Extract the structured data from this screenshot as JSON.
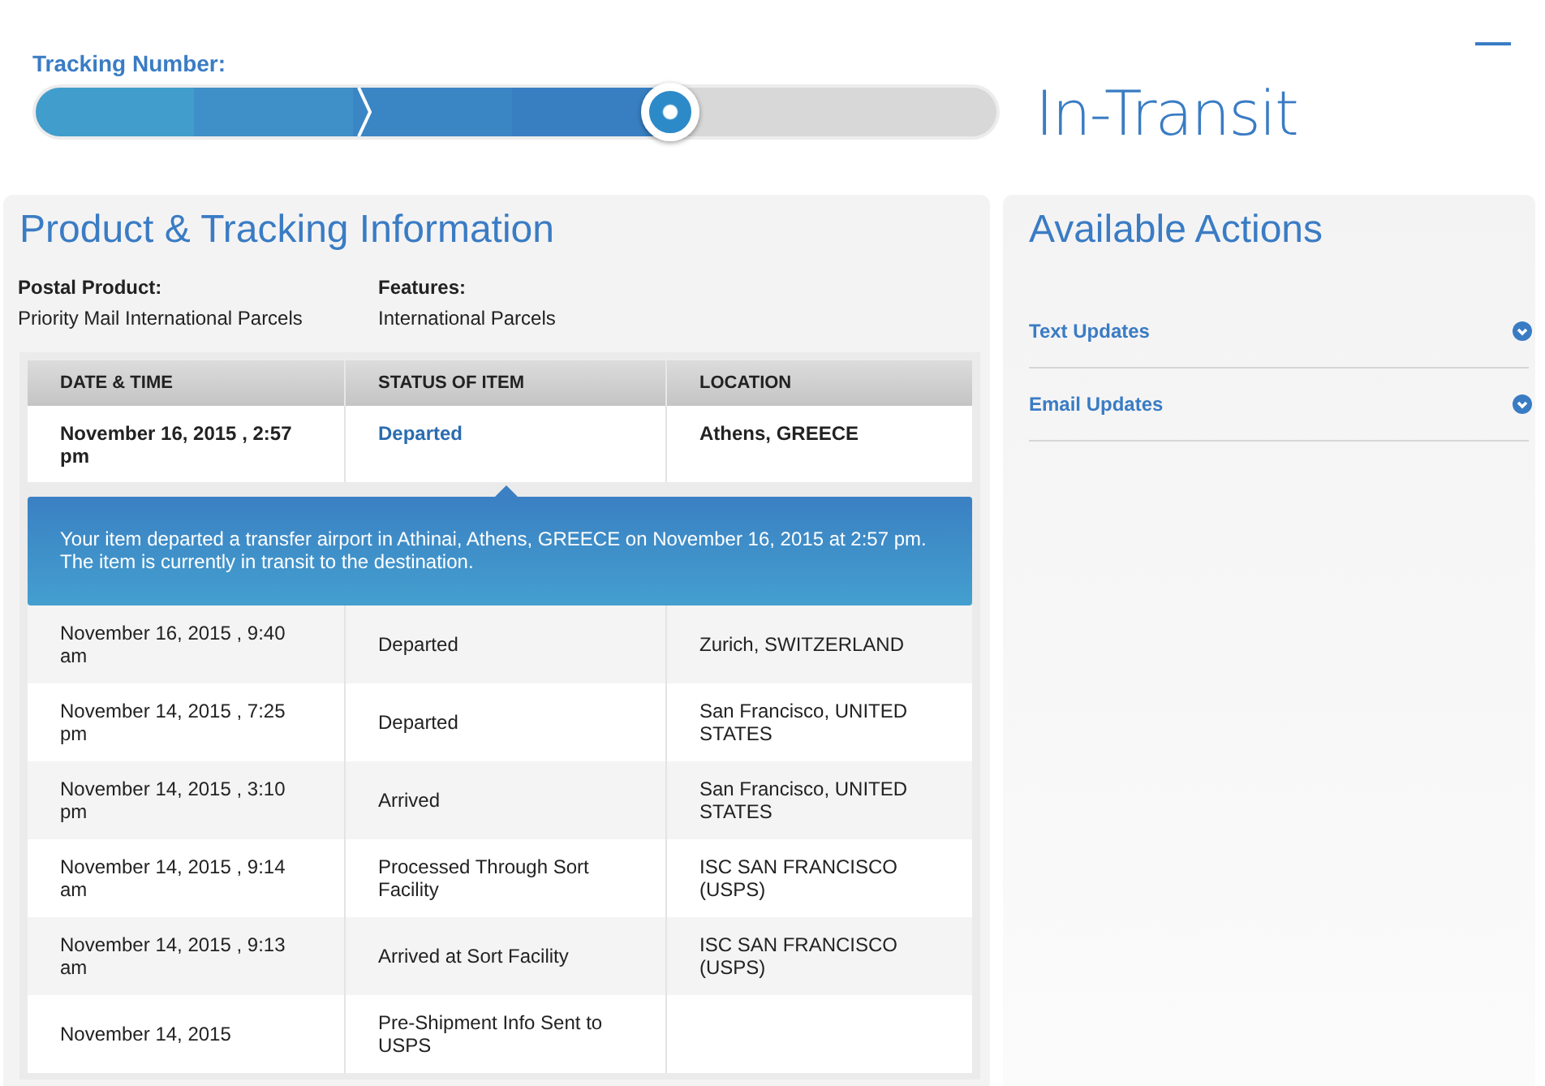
{
  "tracking": {
    "label": "Tracking Number:",
    "level": 0.66,
    "status": "In-Transit"
  },
  "product": {
    "title": "Product & Tracking Information",
    "fields": [
      {
        "label": "Postal Product:",
        "value": "Priority Mail International Parcels"
      },
      {
        "label": "Features:",
        "value": "International Parcels"
      }
    ]
  },
  "table": {
    "columns": [
      "DATE & TIME",
      "STATUS OF ITEM",
      "LOCATION"
    ],
    "rows": [
      {
        "date": "November 16, 2015 , 2:57 pm",
        "status": "Departed",
        "location": "Athens, GREECE",
        "expanded": true,
        "details": "Your item departed a transfer airport in Athinai, Athens, GREECE on November 16, 2015 at 2:57 pm. The item is currently in transit to the destination."
      },
      {
        "date": "November 16, 2015 , 9:40 am",
        "status": "Departed",
        "location": "Zurich, SWITZERLAND",
        "expanded": false
      },
      {
        "date": "November 14, 2015 , 7:25 pm",
        "status": "Departed",
        "location": "San Francisco, UNITED STATES",
        "expanded": false
      },
      {
        "date": "November 14, 2015 , 3:10 pm",
        "status": "Arrived",
        "location": "San Francisco, UNITED STATES",
        "expanded": false
      },
      {
        "date": "November 14, 2015 , 9:14 am",
        "status": "Processed Through Sort Facility",
        "location": "ISC SAN FRANCISCO (USPS)",
        "expanded": false
      },
      {
        "date": "November 14, 2015 , 9:13 am",
        "status": "Arrived at Sort Facility",
        "location": "ISC SAN FRANCISCO (USPS)",
        "expanded": false
      },
      {
        "date": "November 14, 2015",
        "status": "Pre-Shipment Info Sent to USPS",
        "expanded": false
      }
    ]
  },
  "actions": {
    "title": "Available Actions",
    "items": [
      {
        "label": "Text Updates",
        "expanded": false
      },
      {
        "label": "Email Updates",
        "expanded": false
      }
    ]
  }
}
